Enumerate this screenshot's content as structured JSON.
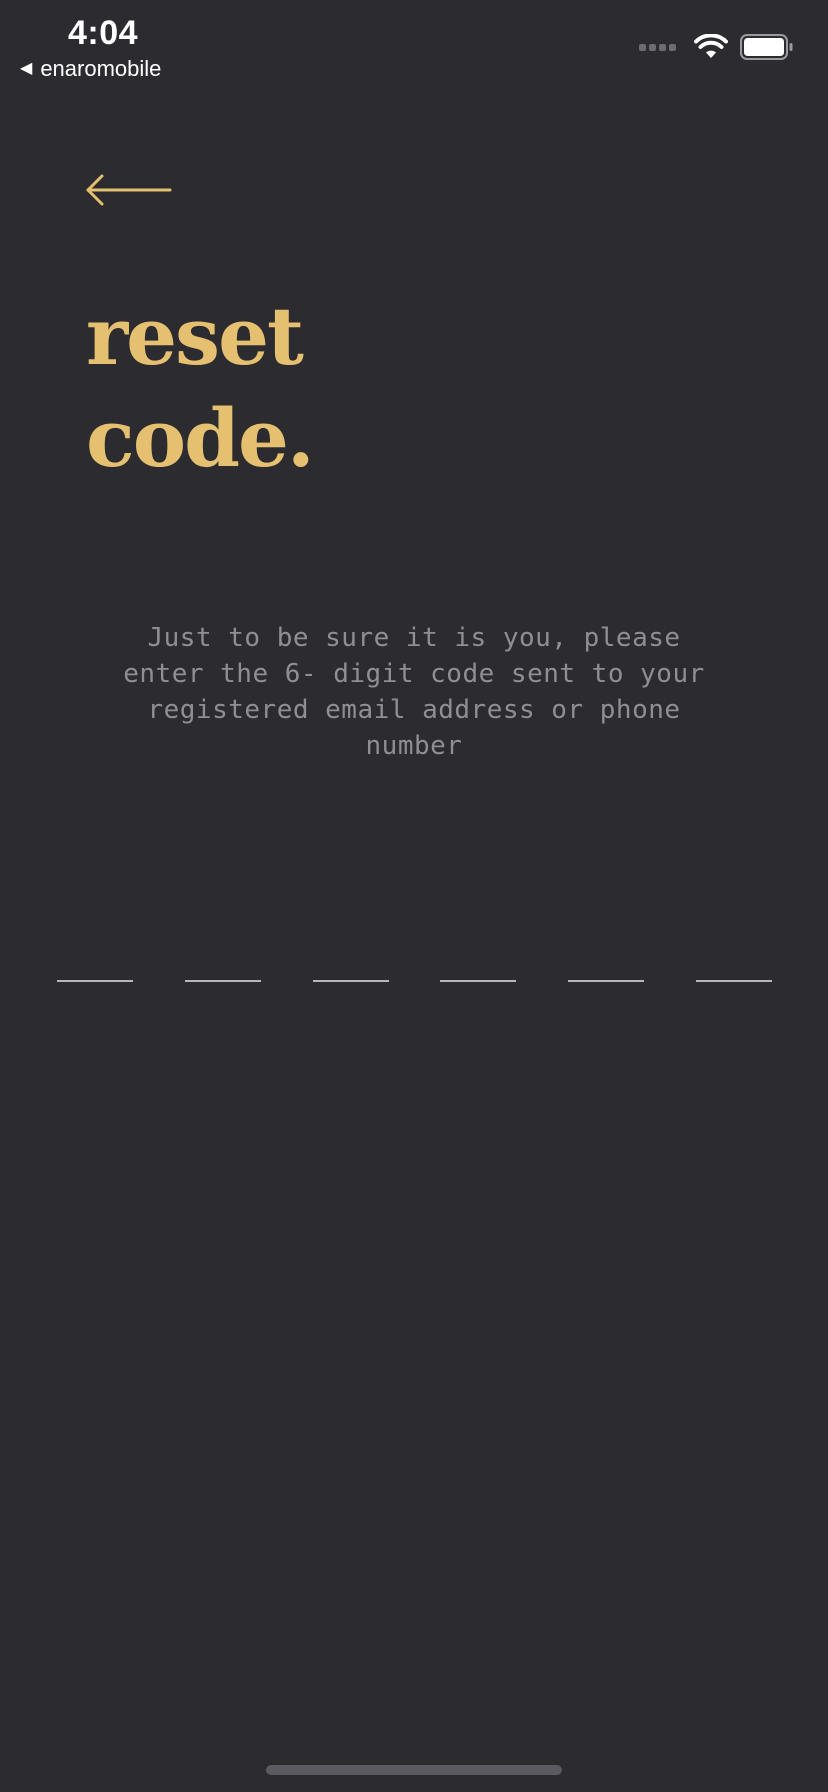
{
  "status_bar": {
    "time": "4:04",
    "back_app": "enaromobile"
  },
  "icons": {
    "back": "arrow-left-icon",
    "wifi": "wifi-icon",
    "battery": "battery-icon",
    "signal": "signal-icon"
  },
  "colors": {
    "background": "#2c2b30",
    "accent": "#e5c070",
    "text_muted": "#8f8e95"
  },
  "screen": {
    "title_line1": "reset",
    "title_line2": "code.",
    "description": "Just to be sure it is you, please enter the 6- digit code sent to your registered email address or phone number",
    "code_inputs": [
      "",
      "",
      "",
      "",
      "",
      ""
    ]
  }
}
